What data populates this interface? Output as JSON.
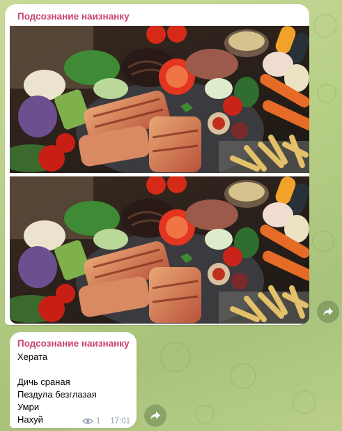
{
  "messages": [
    {
      "sender": "Подсознание наизнанку",
      "attachments": [
        "photo",
        "photo"
      ],
      "share_icon": "share-arrow-icon"
    },
    {
      "sender": "Подсознание наизнанку",
      "lines": [
        "Херата",
        "",
        "Дичь сраная",
        "Пездула безглазая",
        "Умри",
        "Нахуй"
      ],
      "views": "1",
      "time": "17:01",
      "view_icon": "eye-icon",
      "share_icon": "share-arrow-icon"
    }
  ],
  "colors": {
    "sender": "#c8446d",
    "background": "#b7cf85",
    "meta": "#93a1b0"
  }
}
